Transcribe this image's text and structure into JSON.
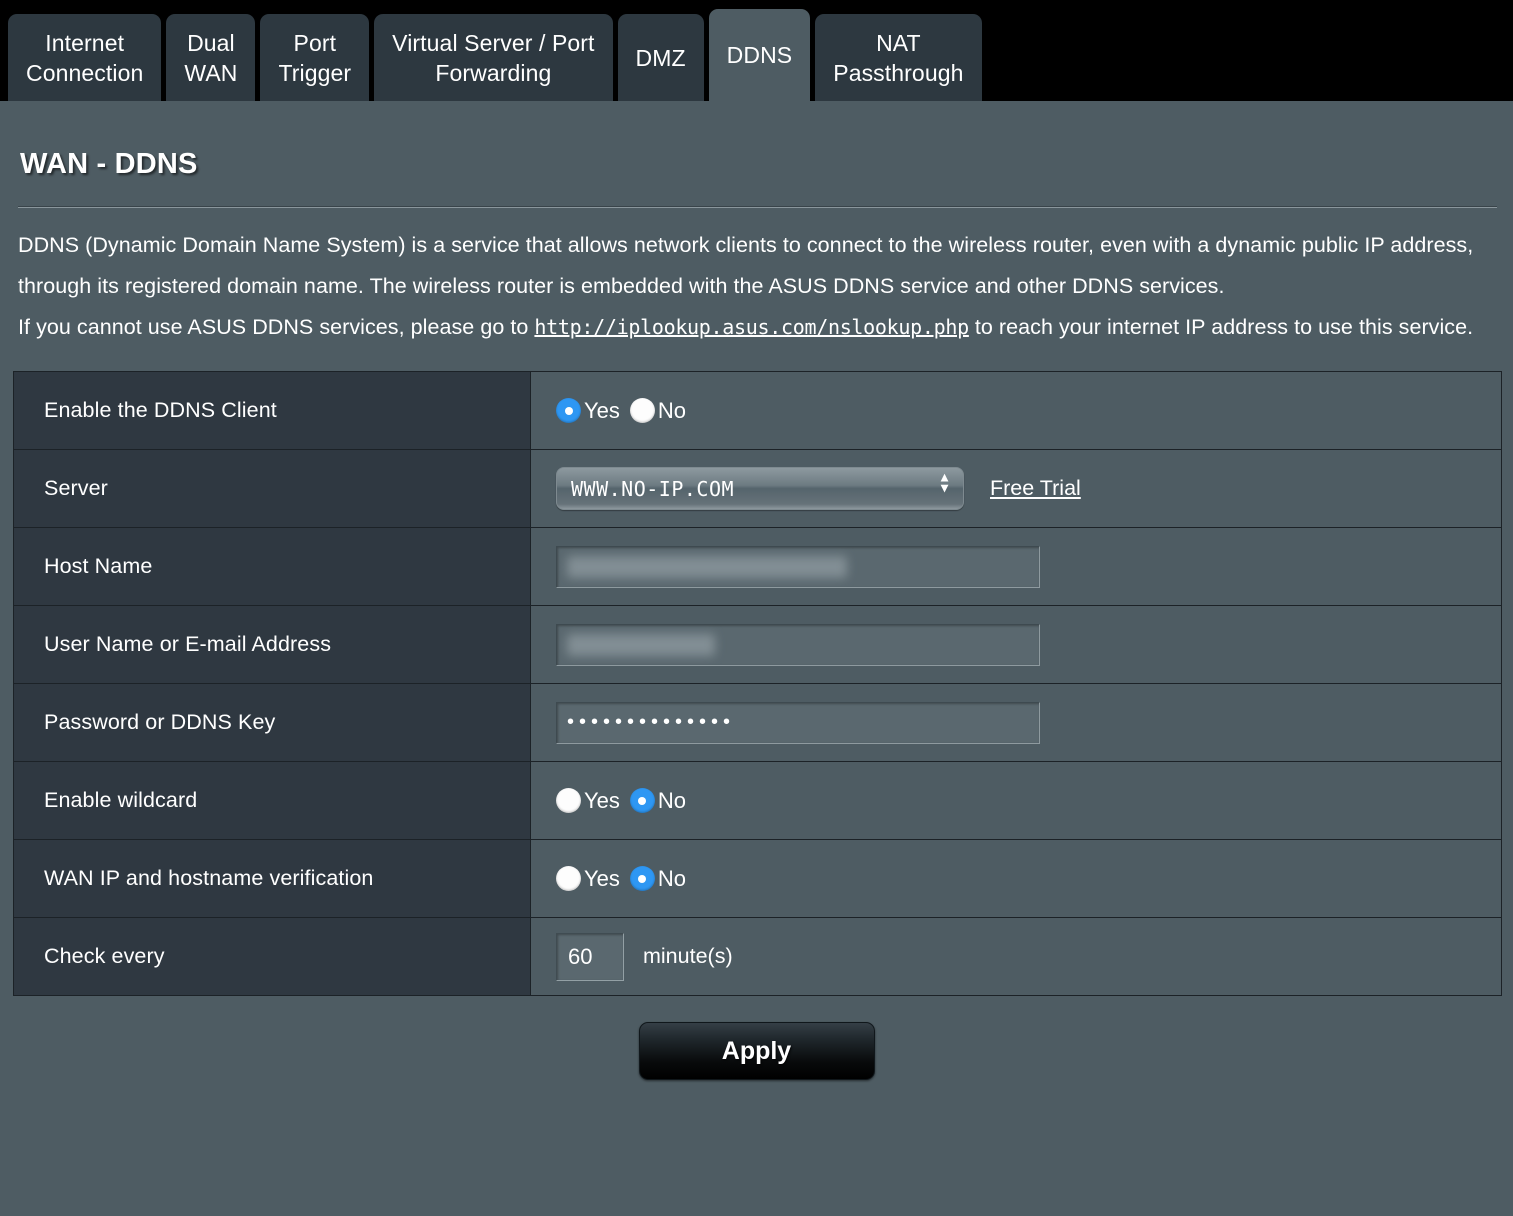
{
  "tabs": [
    {
      "label": "Internet\nConnection",
      "active": false
    },
    {
      "label": "Dual\nWAN",
      "active": false
    },
    {
      "label": "Port\nTrigger",
      "active": false
    },
    {
      "label": "Virtual Server / Port\nForwarding",
      "active": false
    },
    {
      "label": "DMZ",
      "active": false
    },
    {
      "label": "DDNS",
      "active": true
    },
    {
      "label": "NAT\nPassthrough",
      "active": false
    }
  ],
  "page": {
    "title": "WAN - DDNS",
    "description_part1": "DDNS (Dynamic Domain Name System) is a service that allows network clients to connect to the wireless router, even with a dynamic public IP address, through its registered domain name. The wireless router is embedded with the ASUS DDNS service and other DDNS services.",
    "description_part2_before_link": "If you cannot use ASUS DDNS services, please go to ",
    "description_link": "http://iplookup.asus.com/nslookup.php",
    "description_part2_after_link": " to reach your internet IP address to use this service."
  },
  "form": {
    "rows": {
      "enable_ddns": {
        "label": "Enable the DDNS Client",
        "yes_label": "Yes",
        "no_label": "No",
        "selected": "Yes"
      },
      "server": {
        "label": "Server",
        "value": "WWW.NO-IP.COM",
        "free_trial_label": "Free Trial"
      },
      "host_name": {
        "label": "Host Name",
        "value": ""
      },
      "user_name": {
        "label": "User Name or E-mail Address",
        "value": ""
      },
      "password": {
        "label": "Password or DDNS Key",
        "value": "••••••••••••••"
      },
      "wildcard": {
        "label": "Enable wildcard",
        "yes_label": "Yes",
        "no_label": "No",
        "selected": "No"
      },
      "wan_ip_verification": {
        "label": "WAN IP and hostname verification",
        "yes_label": "Yes",
        "no_label": "No",
        "selected": "No"
      },
      "check_every": {
        "label": "Check every",
        "value": "60",
        "unit": "minute(s)"
      }
    },
    "apply_label": "Apply"
  },
  "colors": {
    "page_background": "#4e5c63",
    "label_column": "#2f3841",
    "tab_inactive": "#2d3840",
    "tab_active": "#4e5c63",
    "radio_selected": "#2e97f3",
    "border": "#1c2227",
    "text": "#ffffff"
  }
}
